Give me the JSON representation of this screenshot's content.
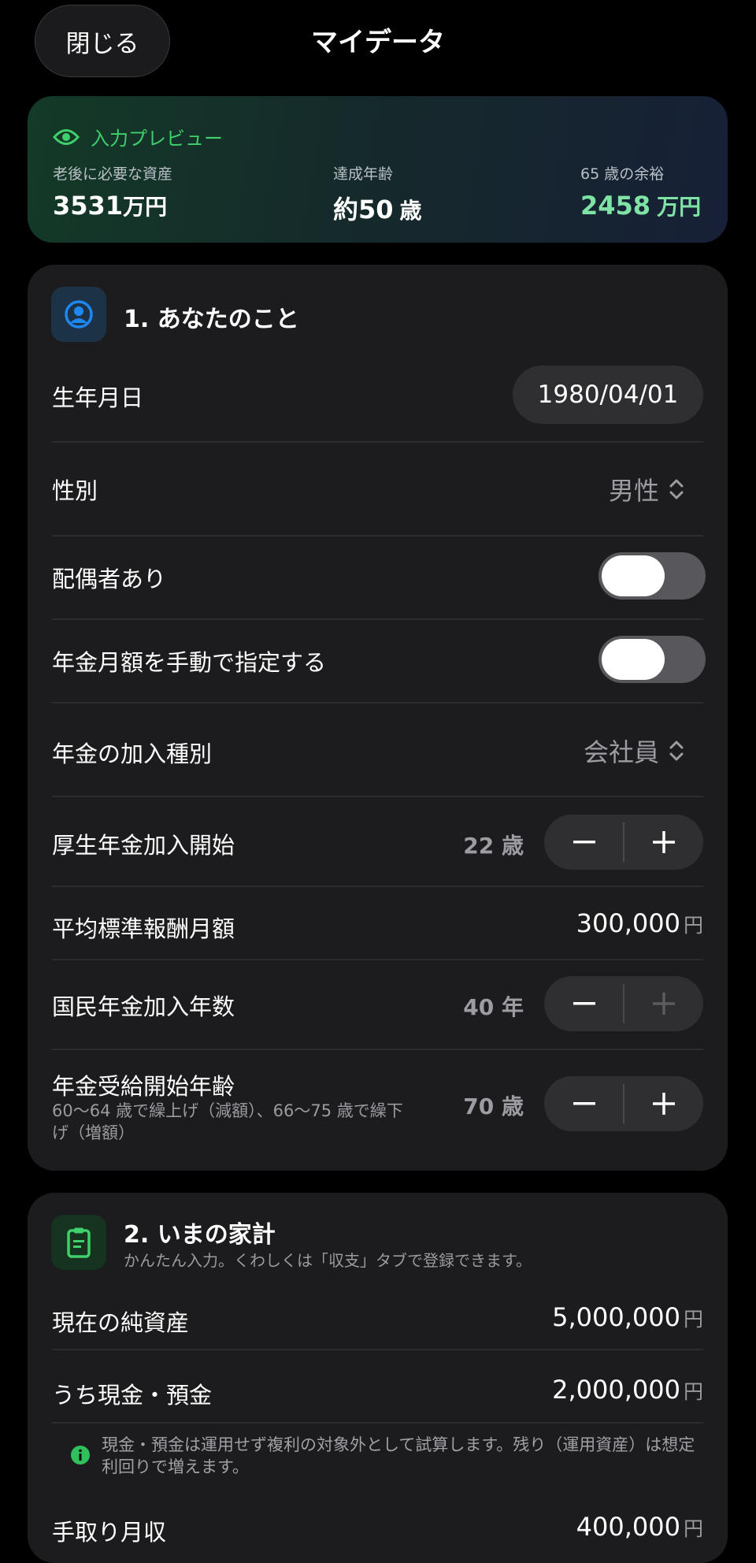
{
  "header": {
    "close_label": "閉じる",
    "title": "マイデータ"
  },
  "preview": {
    "heading": "入力プレビュー",
    "stats": [
      {
        "label": "老後に必要な資産",
        "value": "3531",
        "unit": "万円"
      },
      {
        "label": "達成年齢",
        "value": "約50",
        "unit": "歳"
      },
      {
        "label": "65 歳の余裕",
        "value": "2458",
        "unit": "万円",
        "color": "#7fe3a6"
      }
    ]
  },
  "section1": {
    "title": "1. あなたのこと",
    "birthdate": {
      "label": "生年月日",
      "value": "1980/04/01"
    },
    "gender": {
      "label": "性別",
      "value": "男性"
    },
    "spouse": {
      "label": "配偶者あり",
      "on": false
    },
    "manual_pension": {
      "label": "年金月額を手動で指定する",
      "on": false
    },
    "pension_type": {
      "label": "年金の加入種別",
      "value": "会社員"
    },
    "kosei_start": {
      "label": "厚生年金加入開始",
      "value": "22 歳"
    },
    "avg_salary": {
      "label": "平均標準報酬月額",
      "value": "300,000",
      "unit": "円"
    },
    "kokumin_years": {
      "label": "国民年金加入年数",
      "value": "40 年"
    },
    "pension_start_age": {
      "label": "年金受給開始年齢",
      "hint": "60〜64 歳で繰上げ（減額）、66〜75 歳で繰下げ（増額）",
      "value": "70 歳"
    }
  },
  "section2": {
    "title": "2. いまの家計",
    "subtitle": "かんたん入力。くわしくは「収支」タブで登録できます。",
    "net_assets": {
      "label": "現在の純資産",
      "value": "5,000,000",
      "unit": "円"
    },
    "cash": {
      "label": "うち現金・預金",
      "value": "2,000,000",
      "unit": "円"
    },
    "note": "現金・預金は運用せず複利の対象外として試算します。残り（運用資産）は想定利回りで増えます。",
    "income": {
      "label": "手取り月収",
      "value": "400,000",
      "unit": "円"
    }
  },
  "colors": {
    "accent_green": "#3fcf6b",
    "card_bg": "#1c1c1e",
    "blue_icon": "#1e88f0"
  }
}
